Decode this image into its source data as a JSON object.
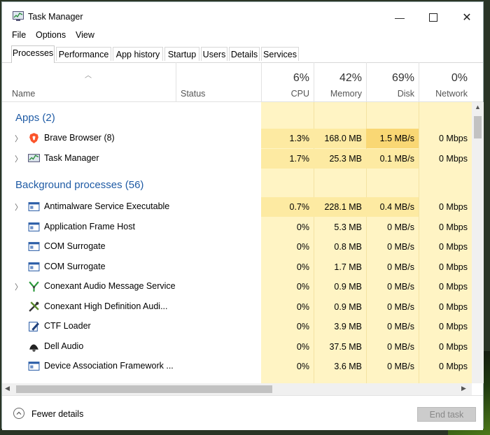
{
  "window": {
    "title": "Task Manager"
  },
  "menu": [
    "File",
    "Options",
    "View"
  ],
  "tabs": [
    "Processes",
    "Performance",
    "App history",
    "Startup",
    "Users",
    "Details",
    "Services"
  ],
  "header": {
    "name": "Name",
    "status": "Status",
    "cpu": {
      "pct": "6%",
      "label": "CPU"
    },
    "memory": {
      "pct": "42%",
      "label": "Memory"
    },
    "disk": {
      "pct": "69%",
      "label": "Disk"
    },
    "network": {
      "pct": "0%",
      "label": "Network"
    }
  },
  "groups": {
    "apps": "Apps (2)",
    "background": "Background processes (56)"
  },
  "apps": [
    {
      "name": "Brave Browser (8)",
      "cpu": "1.3%",
      "memory": "168.0 MB",
      "disk": "1.5 MB/s",
      "network": "0 Mbps",
      "icon": "brave-icon"
    },
    {
      "name": "Task Manager",
      "cpu": "1.7%",
      "memory": "25.3 MB",
      "disk": "0.1 MB/s",
      "network": "0 Mbps",
      "icon": "task-manager-icon"
    }
  ],
  "background": [
    {
      "name": "Antimalware Service Executable",
      "cpu": "0.7%",
      "memory": "228.1 MB",
      "disk": "0.4 MB/s",
      "network": "0 Mbps",
      "icon": "window-icon"
    },
    {
      "name": "Application Frame Host",
      "cpu": "0%",
      "memory": "5.3 MB",
      "disk": "0 MB/s",
      "network": "0 Mbps",
      "icon": "window-icon"
    },
    {
      "name": "COM Surrogate",
      "cpu": "0%",
      "memory": "0.8 MB",
      "disk": "0 MB/s",
      "network": "0 Mbps",
      "icon": "window-icon"
    },
    {
      "name": "COM Surrogate",
      "cpu": "0%",
      "memory": "1.7 MB",
      "disk": "0 MB/s",
      "network": "0 Mbps",
      "icon": "window-icon"
    },
    {
      "name": "Conexant Audio Message Service",
      "cpu": "0%",
      "memory": "0.9 MB",
      "disk": "0 MB/s",
      "network": "0 Mbps",
      "icon": "conexant-icon"
    },
    {
      "name": "Conexant High Definition Audi...",
      "cpu": "0%",
      "memory": "0.9 MB",
      "disk": "0 MB/s",
      "network": "0 Mbps",
      "icon": "tools-icon"
    },
    {
      "name": "CTF Loader",
      "cpu": "0%",
      "memory": "3.9 MB",
      "disk": "0 MB/s",
      "network": "0 Mbps",
      "icon": "ctf-icon"
    },
    {
      "name": "Dell Audio",
      "cpu": "0%",
      "memory": "37.5 MB",
      "disk": "0 MB/s",
      "network": "0 Mbps",
      "icon": "dell-audio-icon"
    },
    {
      "name": "Device Association Framework ...",
      "cpu": "0%",
      "memory": "3.6 MB",
      "disk": "0 MB/s",
      "network": "0 Mbps",
      "icon": "window-icon"
    }
  ],
  "footer": {
    "fewer_details": "Fewer details",
    "end_task": "End task"
  },
  "colors": {
    "heat_light": "#fff4c4",
    "heat_mid": "#fdeaa2",
    "heat_strong": "#f9d774",
    "group_text": "#1f5ba5"
  }
}
